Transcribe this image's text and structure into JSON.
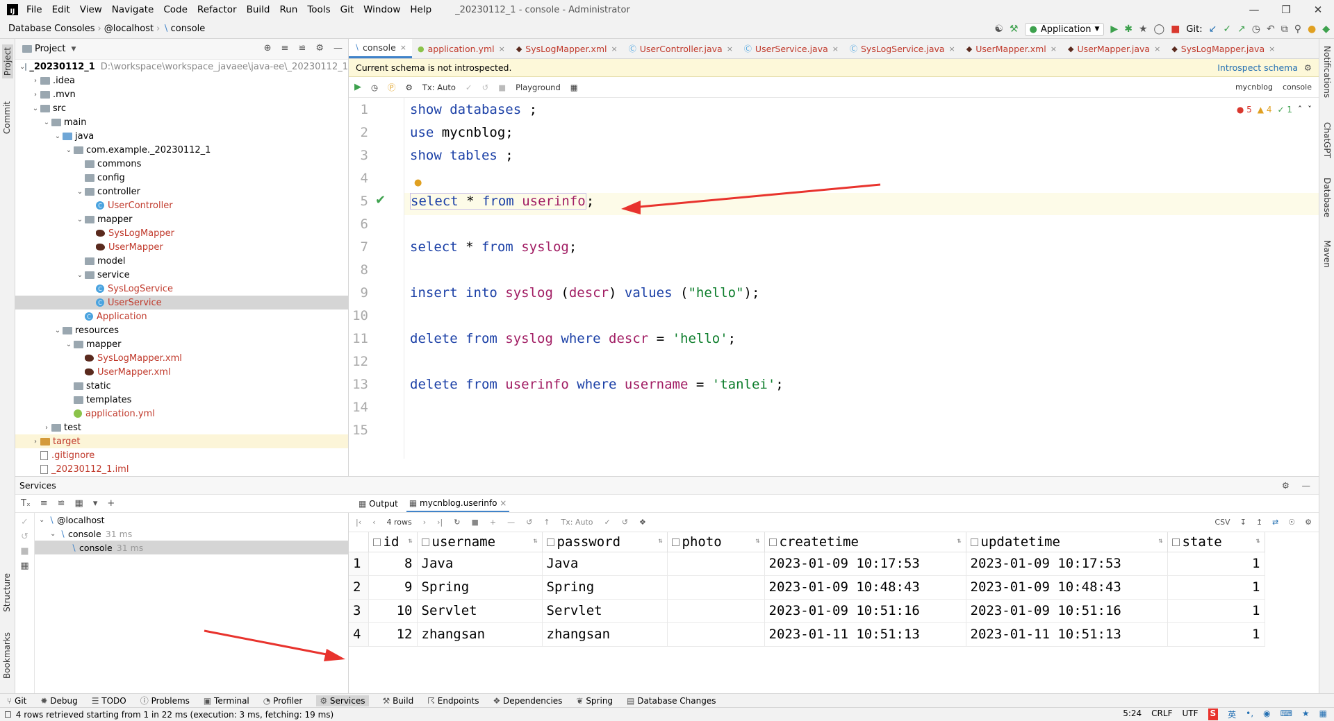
{
  "menubar": {
    "logo": "IJ",
    "items": [
      "File",
      "Edit",
      "View",
      "Navigate",
      "Code",
      "Refactor",
      "Build",
      "Run",
      "Tools",
      "Git",
      "Window",
      "Help"
    ],
    "window_title": "_20230112_1 - console - Administrator"
  },
  "navbar": {
    "crumbs": [
      "Database Consoles",
      "@localhost",
      "console"
    ],
    "run_config": "Application",
    "git_label": "Git:"
  },
  "left_strip": {
    "project": "Project",
    "commit": "Commit",
    "structure": "Structure",
    "bookmarks": "Bookmarks"
  },
  "right_strip": {
    "notifications": "Notifications",
    "chatgpt": "ChatGPT",
    "database": "Database",
    "maven": "Maven"
  },
  "project": {
    "title": "Project",
    "tree": [
      {
        "label": "_20230112_1",
        "path": "D:\\workspace\\workspace_javaee\\java-ee\\_20230112_1",
        "icon": "folder",
        "depth": 0,
        "arrow": "v"
      },
      {
        "label": ".idea",
        "icon": "folder",
        "depth": 1,
        "arrow": ">"
      },
      {
        "label": ".mvn",
        "icon": "folder",
        "depth": 1,
        "arrow": ">"
      },
      {
        "label": "src",
        "icon": "folder",
        "depth": 1,
        "arrow": "v"
      },
      {
        "label": "main",
        "icon": "folder",
        "depth": 2,
        "arrow": "v"
      },
      {
        "label": "java",
        "icon": "folder-blue",
        "depth": 3,
        "arrow": "v"
      },
      {
        "label": "com.example._20230112_1",
        "icon": "folder",
        "depth": 4,
        "arrow": "v"
      },
      {
        "label": "commons",
        "icon": "folder",
        "depth": 5,
        "arrow": ""
      },
      {
        "label": "config",
        "icon": "folder",
        "depth": 5,
        "arrow": ""
      },
      {
        "label": "controller",
        "icon": "folder",
        "depth": 5,
        "arrow": "v"
      },
      {
        "label": "UserController",
        "icon": "class",
        "depth": 6,
        "arrow": "",
        "red": true
      },
      {
        "label": "mapper",
        "icon": "folder",
        "depth": 5,
        "arrow": "v"
      },
      {
        "label": "SysLogMapper",
        "icon": "mybatis",
        "depth": 6,
        "arrow": "",
        "red": true
      },
      {
        "label": "UserMapper",
        "icon": "mybatis",
        "depth": 6,
        "arrow": "",
        "red": true
      },
      {
        "label": "model",
        "icon": "folder",
        "depth": 5,
        "arrow": ""
      },
      {
        "label": "service",
        "icon": "folder",
        "depth": 5,
        "arrow": "v"
      },
      {
        "label": "SysLogService",
        "icon": "class",
        "depth": 6,
        "arrow": "",
        "red": true
      },
      {
        "label": "UserService",
        "icon": "class",
        "depth": 6,
        "arrow": "",
        "red": true,
        "selected": true
      },
      {
        "label": "Application",
        "icon": "class",
        "depth": 5,
        "arrow": "",
        "red": true
      },
      {
        "label": "resources",
        "icon": "folder",
        "depth": 3,
        "arrow": "v"
      },
      {
        "label": "mapper",
        "icon": "folder",
        "depth": 4,
        "arrow": "v"
      },
      {
        "label": "SysLogMapper.xml",
        "icon": "mybatis",
        "depth": 5,
        "arrow": "",
        "red": true
      },
      {
        "label": "UserMapper.xml",
        "icon": "mybatis",
        "depth": 5,
        "arrow": "",
        "red": true
      },
      {
        "label": "static",
        "icon": "folder",
        "depth": 4,
        "arrow": ""
      },
      {
        "label": "templates",
        "icon": "folder",
        "depth": 4,
        "arrow": ""
      },
      {
        "label": "application.yml",
        "icon": "yml",
        "depth": 4,
        "arrow": "",
        "red": true
      },
      {
        "label": "test",
        "icon": "folder",
        "depth": 2,
        "arrow": ">"
      },
      {
        "label": "target",
        "icon": "folder-orange",
        "depth": 1,
        "arrow": ">",
        "red": true,
        "target": true
      },
      {
        "label": ".gitignore",
        "icon": "file",
        "depth": 1,
        "arrow": "",
        "red": true
      },
      {
        "label": "_20230112_1.iml",
        "icon": "file",
        "depth": 1,
        "arrow": "",
        "red": true
      }
    ]
  },
  "tabs": [
    {
      "label": "console",
      "active": true,
      "icon": "console"
    },
    {
      "label": "application.yml",
      "red": true,
      "icon": "yml"
    },
    {
      "label": "SysLogMapper.xml",
      "red": true,
      "icon": "mybatis"
    },
    {
      "label": "UserController.java",
      "red": true,
      "icon": "class"
    },
    {
      "label": "UserService.java",
      "red": true,
      "icon": "class"
    },
    {
      "label": "SysLogService.java",
      "red": true,
      "icon": "class"
    },
    {
      "label": "UserMapper.xml",
      "red": true,
      "icon": "mybatis"
    },
    {
      "label": "UserMapper.java",
      "red": true,
      "icon": "mybatis"
    },
    {
      "label": "SysLogMapper.java",
      "red": true,
      "icon": "mybatis"
    }
  ],
  "schema_bar": {
    "message": "Current schema is not introspected.",
    "link": "Introspect schema"
  },
  "editor_toolbar": {
    "tx": "Tx: Auto",
    "playground": "Playground",
    "schema": "mycnblog",
    "console": "console"
  },
  "inspections": {
    "errors": "5",
    "warnings": "4",
    "ok": "1"
  },
  "code": {
    "line_numbers": [
      "1",
      "2",
      "3",
      "4",
      "5",
      "6",
      "7",
      "8",
      "9",
      "10",
      "11",
      "12",
      "13",
      "14",
      "15"
    ]
  },
  "services": {
    "title": "Services",
    "tree": [
      {
        "label": "@localhost",
        "ms": ""
      },
      {
        "label": "console",
        "ms": "31 ms"
      },
      {
        "label": "console",
        "ms": "31 ms",
        "selected": true
      }
    ],
    "out_tabs": [
      "Output",
      "mycnblog.userinfo"
    ],
    "rows_label": "4 rows",
    "tx": "Tx: Auto",
    "export": "CSV"
  },
  "result": {
    "columns": [
      "id",
      "username",
      "password",
      "photo",
      "createtime",
      "updatetime",
      "state"
    ],
    "rows": [
      {
        "n": "1",
        "id": "8",
        "username": "Java",
        "password": "Java",
        "photo": "",
        "createtime": "2023-01-09 10:17:53",
        "updatetime": "2023-01-09 10:17:53",
        "state": "1"
      },
      {
        "n": "2",
        "id": "9",
        "username": "Spring",
        "password": "Spring",
        "photo": "",
        "createtime": "2023-01-09 10:48:43",
        "updatetime": "2023-01-09 10:48:43",
        "state": "1"
      },
      {
        "n": "3",
        "id": "10",
        "username": "Servlet",
        "password": "Servlet",
        "photo": "",
        "createtime": "2023-01-09 10:51:16",
        "updatetime": "2023-01-09 10:51:16",
        "state": "1"
      },
      {
        "n": "4",
        "id": "12",
        "username": "zhangsan",
        "password": "zhangsan",
        "photo": "",
        "createtime": "2023-01-11 10:51:13",
        "updatetime": "2023-01-11 10:51:13",
        "state": "1"
      }
    ]
  },
  "bottom_tools": [
    "Git",
    "Debug",
    "TODO",
    "Problems",
    "Terminal",
    "Profiler",
    "Services",
    "Build",
    "Endpoints",
    "Dependencies",
    "Spring",
    "Database Changes"
  ],
  "status": {
    "message": "4 rows retrieved starting from 1 in 22 ms (execution: 3 ms, fetching: 19 ms)",
    "position": "5:24",
    "line_sep": "CRLF",
    "encoding": "UTF",
    "ime": "英"
  },
  "colors": {
    "keyword": "#1a3fa6",
    "identifier": "#a11d63",
    "string": "#0c7d2b",
    "arrow": "#e8332d"
  }
}
